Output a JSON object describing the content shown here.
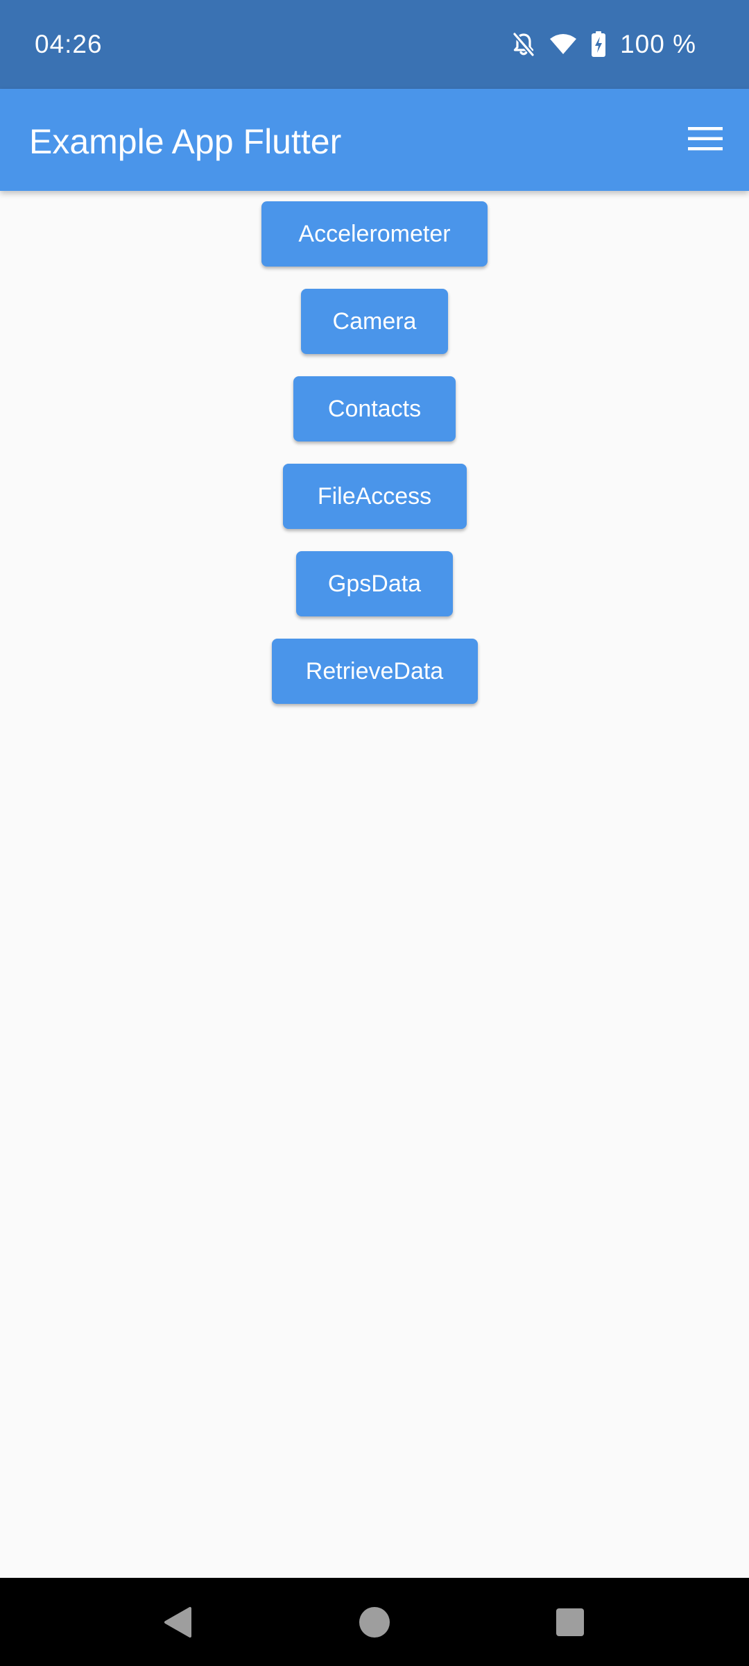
{
  "status_bar": {
    "time": "04:26",
    "battery": "100 %",
    "icons": [
      "notifications-off-icon",
      "wifi-icon",
      "battery-charging-icon"
    ]
  },
  "app_bar": {
    "title": "Example App Flutter",
    "menu_icon": "hamburger-menu-icon"
  },
  "buttons": {
    "accelerometer": "Accelerometer",
    "camera": "Camera",
    "contacts": "Contacts",
    "file_access": "FileAccess",
    "gps_data": "GpsData",
    "retrieve_data": "RetrieveData"
  },
  "nav_bar": {
    "icons": [
      "back-icon",
      "home-icon",
      "recents-icon"
    ]
  },
  "colors": {
    "status_bar": "#3a72b3",
    "app_bar": "#4a95ea",
    "button": "#4a95ea",
    "background": "#fafafa",
    "nav_bar": "#000000"
  }
}
